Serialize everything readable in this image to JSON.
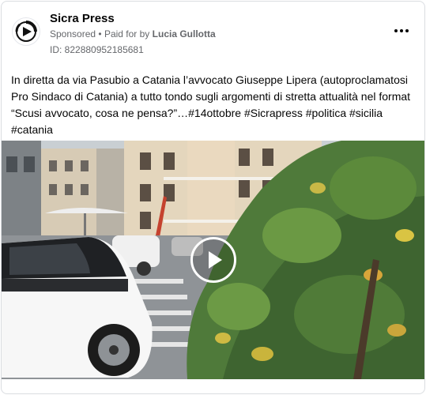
{
  "post": {
    "page_name": "Sicra Press",
    "sponsored_label": "Sponsored",
    "separator": "•",
    "paid_for_prefix": "Paid for by",
    "payer_name": "Lucia Gullotta",
    "ad_id": "ID: 822880952185681",
    "text": "In diretta da via Pasubio a Catania l’avvocato Giuseppe Lipera (autoproclamatosi Pro Sindaco di Catania) a tutto tondo sugli argomenti di stretta attualità nel format “Scusi avvocato, cosa ne pensa?”…#14ottobre #Sicrapress #politica #sicilia #catania"
  },
  "icons": {
    "avatar": "page-logo-play",
    "more": "more-horizontal-icon",
    "play": "play-icon"
  },
  "colors": {
    "text_primary": "#050505",
    "text_secondary": "#65676b",
    "border": "#dadde1"
  }
}
